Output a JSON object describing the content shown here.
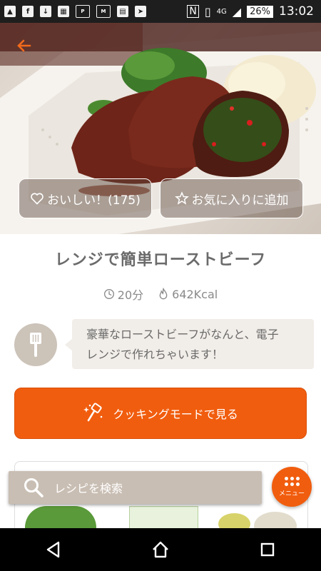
{
  "status_bar": {
    "network": "4G",
    "battery": "26%",
    "time": "13:02",
    "icons": [
      "notification-icon",
      "facebook-icon",
      "download-icon",
      "gallery-icon",
      "ponta-icon",
      "mobile-icon",
      "calendar-icon",
      "maps-icon",
      "nfc-icon",
      "vibrate-icon",
      "signal-icon"
    ]
  },
  "hero": {
    "back_icon": "back-arrow-icon",
    "like_label": "おいしい！(175)",
    "favorite_label": "お気に入りに追加"
  },
  "recipe": {
    "title": "レンジで簡単ローストビーフ",
    "time": "20分",
    "calories": "642Kcal"
  },
  "comment": {
    "line1": "豪華なローストビーフがなんと、電子",
    "line2": "レンジで作れちゃいます！"
  },
  "cooking_mode": {
    "label": "クッキングモードで見る"
  },
  "search": {
    "placeholder": "レシピを検索"
  },
  "menu": {
    "label": "メニュー"
  },
  "colors": {
    "accent": "#f15d0e",
    "back_arrow": "#f26a1b",
    "bubble_bg": "#f1ede8",
    "search_bg": "#c9beb3"
  }
}
